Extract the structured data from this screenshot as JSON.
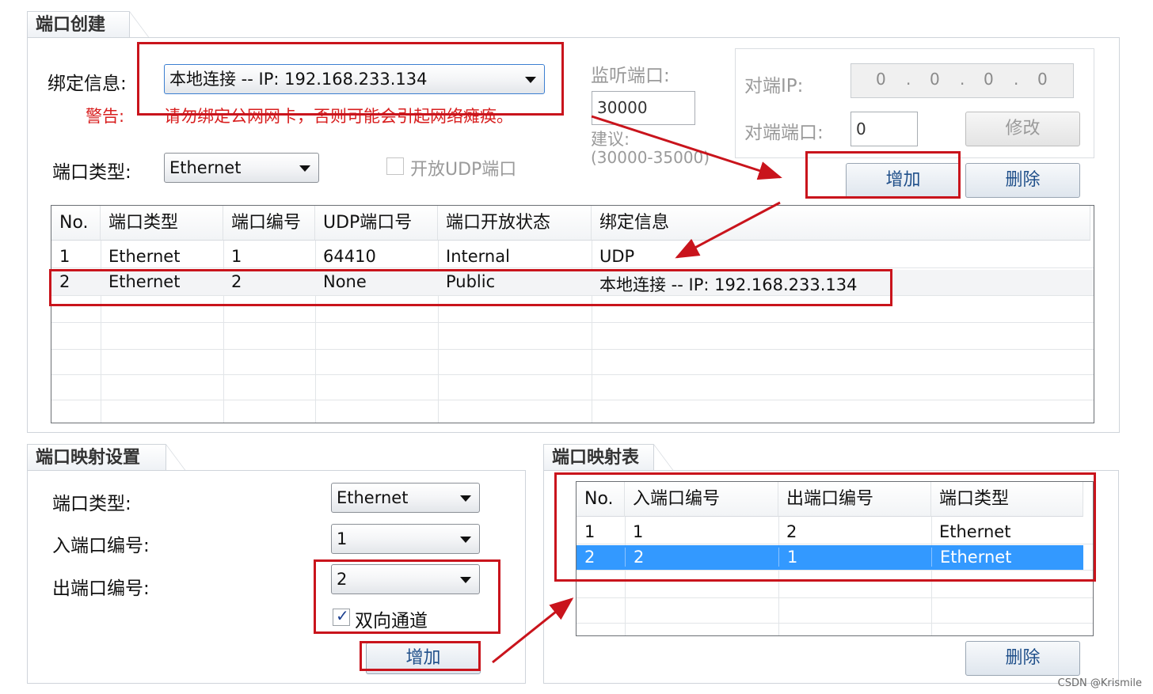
{
  "port_create": {
    "title": "端口创建",
    "bind_label": "绑定信息:",
    "bind_value": "本地连接 -- IP: 192.168.233.134",
    "warning_label": "警告:",
    "warning_text": "请勿绑定公网网卡，否则可能会引起网络瘫痪。",
    "port_type_label": "端口类型:",
    "port_type_value": "Ethernet",
    "open_udp_label": "开放UDP端口",
    "listen_port_label": "监听端口:",
    "listen_port_value": "30000",
    "suggest_label": "建议:",
    "suggest_range": "(30000-35000)",
    "peer_ip_label": "对端IP:",
    "peer_ip_octets": [
      "0",
      "0",
      "0",
      "0"
    ],
    "peer_port_label": "对端端口:",
    "peer_port_value": "0",
    "modify_button": "修改",
    "add_button": "增加",
    "delete_button": "删除",
    "table": {
      "columns": [
        "No.",
        "端口类型",
        "端口编号",
        "UDP端口号",
        "端口开放状态",
        "绑定信息"
      ],
      "rows": [
        [
          "1",
          "Ethernet",
          "1",
          "64410",
          "Internal",
          "UDP"
        ],
        [
          "2",
          "Ethernet",
          "2",
          "None",
          "Public",
          "本地连接 -- IP: 192.168.233.134"
        ]
      ]
    }
  },
  "mapping_settings": {
    "title": "端口映射设置",
    "port_type_label": "端口类型:",
    "port_type_value": "Ethernet",
    "in_port_label": "入端口编号:",
    "in_port_value": "1",
    "out_port_label": "出端口编号:",
    "out_port_value": "2",
    "bidirectional_label": "双向通道",
    "add_button": "增加"
  },
  "mapping_table": {
    "title": "端口映射表",
    "columns": [
      "No.",
      "入端口编号",
      "出端口编号",
      "端口类型"
    ],
    "rows": [
      [
        "1",
        "1",
        "2",
        "Ethernet"
      ],
      [
        "2",
        "2",
        "1",
        "Ethernet"
      ]
    ],
    "delete_button": "删除"
  },
  "watermark": "CSDN @Krismile",
  "colors": {
    "annotation_red": "#c9141c",
    "selection_blue": "#3399ff",
    "warning_red": "#d81e1e"
  }
}
